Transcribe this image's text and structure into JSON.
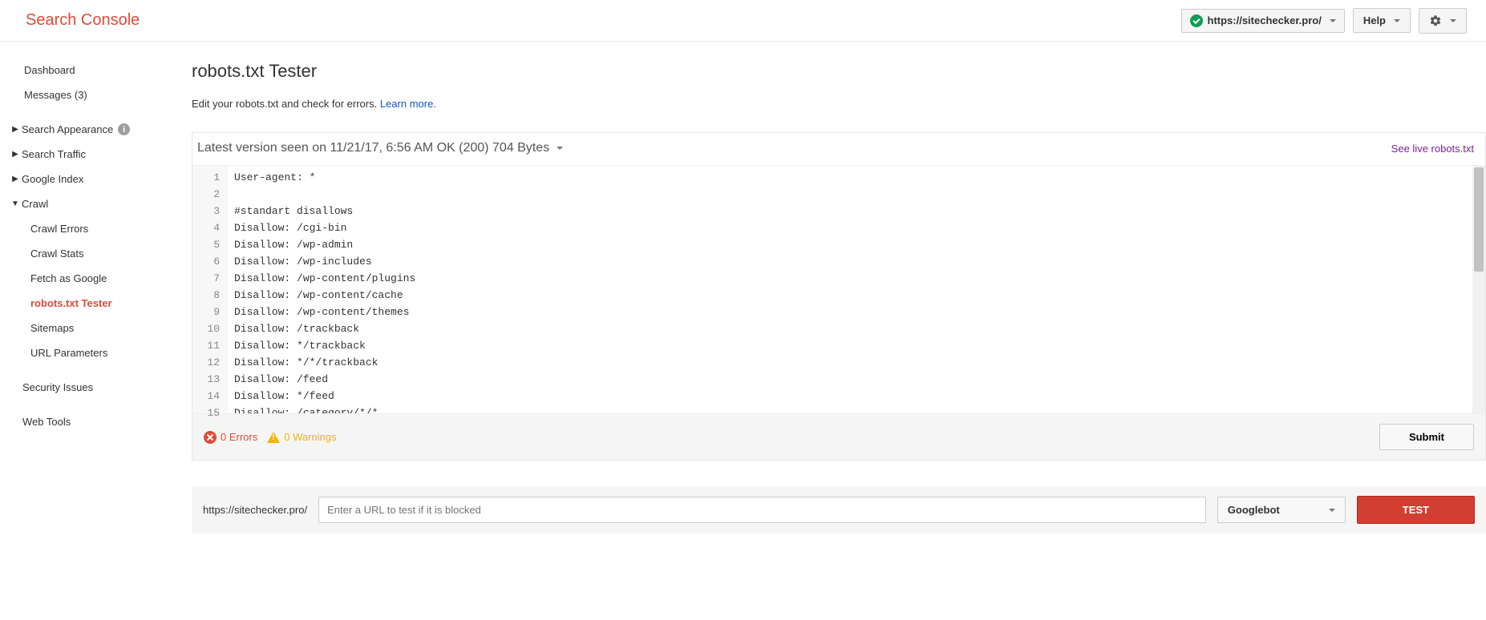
{
  "header": {
    "logo": "Search Console",
    "property": "https://sitechecker.pro/",
    "help": "Help"
  },
  "sidebar": {
    "items": [
      {
        "label": "Dashboard",
        "type": "item"
      },
      {
        "label": "Messages (3)",
        "type": "item"
      },
      {
        "label": "Search Appearance",
        "type": "section",
        "info": true
      },
      {
        "label": "Search Traffic",
        "type": "section"
      },
      {
        "label": "Google Index",
        "type": "section"
      },
      {
        "label": "Crawl",
        "type": "section",
        "open": true
      },
      {
        "label": "Crawl Errors",
        "type": "sub"
      },
      {
        "label": "Crawl Stats",
        "type": "sub"
      },
      {
        "label": "Fetch as Google",
        "type": "sub"
      },
      {
        "label": "robots.txt Tester",
        "type": "sub",
        "selected": true
      },
      {
        "label": "Sitemaps",
        "type": "sub"
      },
      {
        "label": "URL Parameters",
        "type": "sub"
      },
      {
        "label": "Security Issues",
        "type": "item"
      },
      {
        "label": "Web Tools",
        "type": "item"
      }
    ]
  },
  "page": {
    "title": "robots.txt Tester",
    "subtitle_prefix": "Edit your robots.txt and check for errors. ",
    "learn_more": "Learn more.",
    "version": "Latest version seen on 11/21/17, 6:56 AM OK (200) 704 Bytes",
    "live_link": "See live robots.txt"
  },
  "code": {
    "lines": [
      "User-agent: *",
      "",
      "#standart disallows",
      "Disallow: /cgi-bin",
      "Disallow: /wp-admin",
      "Disallow: /wp-includes",
      "Disallow: /wp-content/plugins",
      "Disallow: /wp-content/cache",
      "Disallow: /wp-content/themes",
      "Disallow: /trackback",
      "Disallow: */trackback",
      "Disallow: */*/trackback",
      "Disallow: /feed",
      "Disallow: */feed",
      "Disallow: /category/*/*"
    ]
  },
  "errors": {
    "count_text": "0 Errors",
    "warn_text": "0 Warnings",
    "submit": "Submit"
  },
  "tester": {
    "prefix": "https://sitechecker.pro/",
    "placeholder": "Enter a URL to test if it is blocked",
    "bot": "Googlebot",
    "test": "TEST"
  }
}
